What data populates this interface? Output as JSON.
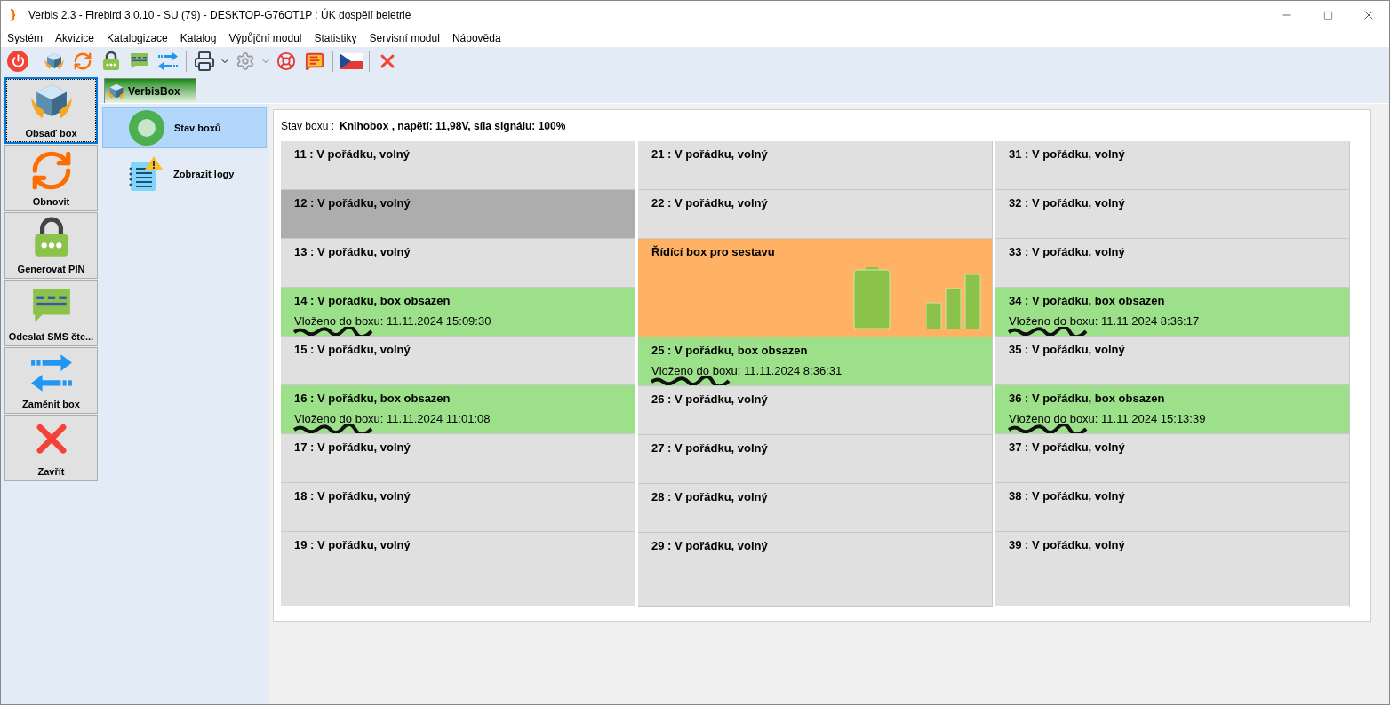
{
  "window": {
    "title": "Verbis 2.3 - Firebird 3.0.10 - SU (79) - DESKTOP-G76OT1P : ÚK dospělí beletrie"
  },
  "menu": [
    "Systém",
    "Akvizice",
    "Katalogizace",
    "Katalog",
    "Výpůjční modul",
    "Statistiky",
    "Servisní modul",
    "Nápověda"
  ],
  "sidebar": {
    "items": [
      {
        "kind": "box",
        "label": "Obsaď box",
        "selected": true
      },
      {
        "kind": "refresh",
        "label": "Obnovit",
        "selected": false
      },
      {
        "kind": "lock",
        "label": "Generovat PIN",
        "selected": false
      },
      {
        "kind": "sms",
        "label": "Odeslat SMS čte...",
        "selected": false
      },
      {
        "kind": "swap",
        "label": "Zaměnit box",
        "selected": false
      },
      {
        "kind": "close",
        "label": "Zavřít",
        "selected": false
      }
    ]
  },
  "tab": {
    "label": "VerbisBox"
  },
  "nav": [
    {
      "kind": "status",
      "label": "Stav boxů",
      "selected": true
    },
    {
      "kind": "logs",
      "label": "Zobrazit logy",
      "selected": false
    }
  ],
  "status": {
    "label": "Stav boxu :",
    "value": "Knihobox , napětí: 11,98V, síla signálu: 100%"
  },
  "columns": [
    {
      "cells": [
        {
          "kind": "free",
          "title": "11 : V pořádku, volný",
          "selected": false
        },
        {
          "kind": "free",
          "title": "12 : V pořádku, volný",
          "selected": true
        },
        {
          "kind": "free",
          "title": "13 : V pořádku, volný",
          "selected": false
        },
        {
          "kind": "occupied",
          "title": "14 : V pořádku, box obsazen",
          "inserted": "Vloženo do boxu: 11.11.2024 15:09:30",
          "selected": false
        },
        {
          "kind": "free",
          "title": "15 : V pořádku, volný",
          "selected": false
        },
        {
          "kind": "occupied",
          "title": "16 : V pořádku, box obsazen",
          "inserted": "Vloženo do boxu: 11.11.2024 11:01:08",
          "selected": false
        },
        {
          "kind": "free",
          "title": "17 : V pořádku, volný",
          "selected": false
        },
        {
          "kind": "free",
          "title": "18 : V pořádku, volný",
          "selected": false
        },
        {
          "kind": "free",
          "title": "19 : V pořádku, volný",
          "selected": false
        }
      ]
    },
    {
      "cells": [
        {
          "kind": "free",
          "title": "21 : V pořádku, volný",
          "selected": false
        },
        {
          "kind": "free",
          "title": "22 : V pořádku, volný",
          "selected": false
        },
        {
          "kind": "controller",
          "title": "Řídící box pro sestavu",
          "selected": false
        },
        {
          "kind": "occupied",
          "title": "25 : V pořádku, box obsazen",
          "inserted": "Vloženo do boxu: 11.11.2024 8:36:31",
          "selected": false
        },
        {
          "kind": "free",
          "title": "26 : V pořádku, volný",
          "selected": false
        },
        {
          "kind": "free",
          "title": "27 : V pořádku, volný",
          "selected": false
        },
        {
          "kind": "free",
          "title": "28 : V pořádku, volný",
          "selected": false
        },
        {
          "kind": "free",
          "title": "29 : V pořádku, volný",
          "selected": false
        }
      ]
    },
    {
      "cells": [
        {
          "kind": "free",
          "title": "31 : V pořádku, volný",
          "selected": false
        },
        {
          "kind": "free",
          "title": "32 : V pořádku, volný",
          "selected": false
        },
        {
          "kind": "free",
          "title": "33 : V pořádku, volný",
          "selected": false
        },
        {
          "kind": "occupied",
          "title": "34 : V pořádku, box obsazen",
          "inserted": "Vloženo do boxu: 11.11.2024 8:36:17",
          "selected": false
        },
        {
          "kind": "free",
          "title": "35 : V pořádku, volný",
          "selected": false
        },
        {
          "kind": "occupied",
          "title": "36 : V pořádku, box obsazen",
          "inserted": "Vloženo do boxu: 11.11.2024 15:13:39",
          "selected": false
        },
        {
          "kind": "free",
          "title": "37 : V pořádku, volný",
          "selected": false
        },
        {
          "kind": "free",
          "title": "38 : V pořádku, volný",
          "selected": false
        },
        {
          "kind": "free",
          "title": "39 : V pořádku, volný",
          "selected": false
        }
      ]
    }
  ]
}
